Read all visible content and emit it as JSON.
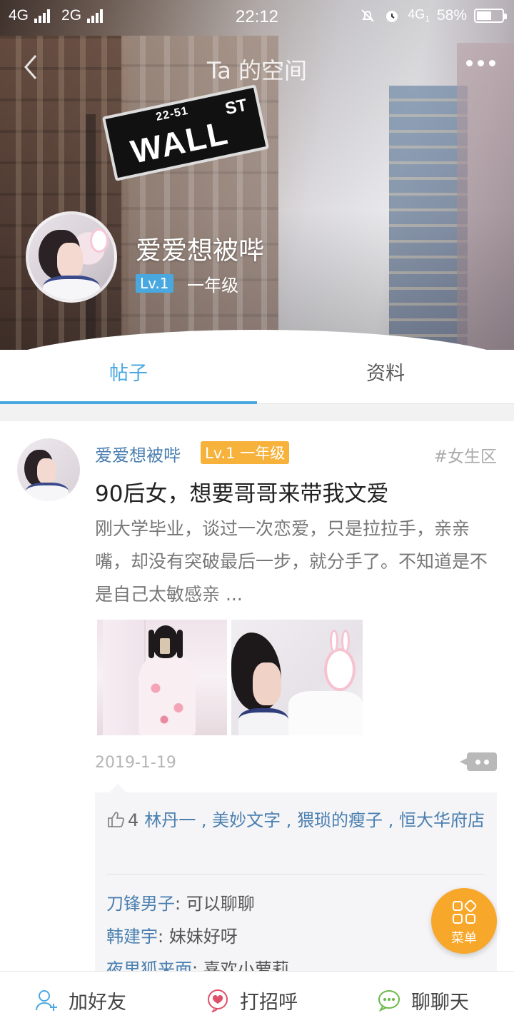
{
  "status_bar": {
    "network1": "4G",
    "network2": "2G",
    "time": "22:12",
    "network3": "4G",
    "network3_sub": "1",
    "battery": "58%",
    "battery_level": 0.58
  },
  "nav": {
    "title": "Ta 的空间"
  },
  "cover": {
    "sign_number": "22-51",
    "sign_main": "WALL",
    "sign_st": "ST"
  },
  "profile": {
    "name": "爱爱想被哔",
    "level": "Lv.1",
    "grade": "一年级"
  },
  "tabs": [
    {
      "label": "帖子",
      "active": true
    },
    {
      "label": "资料",
      "active": false
    }
  ],
  "post": {
    "author": "爱爱想被哔",
    "level_badge": "Lv.1 一年级",
    "tag": "#女生区",
    "title": "90后女，想要哥哥来带我文爱",
    "body": "刚大学毕业，谈过一次恋爱，只是拉拉手，亲亲嘴，却没有突破最后一步，就分手了。不知道是不是自己太敏感亲 ...",
    "date": "2019-1-19",
    "like_count": "4",
    "likers": [
      "林丹一",
      "美妙文字",
      "猥琐的瘦子",
      "恒大华府店"
    ],
    "comments": [
      {
        "author": "刀锋男子",
        "text": "可以聊聊"
      },
      {
        "author": "韩建宇",
        "text": "妹妹好呀"
      },
      {
        "author": "夜里狐来面",
        "text": "喜欢小萝莉"
      }
    ]
  },
  "fab": {
    "label": "菜单"
  },
  "bottom_bar": {
    "add_friend": "加好友",
    "greet": "打招呼",
    "chat": "聊聊天"
  },
  "colors": {
    "accent_blue": "#4aa8e0",
    "link_blue": "#4a7fb0",
    "level_orange": "#f6b23b",
    "fab_orange": "#f7a72a",
    "greet_red": "#e0506a",
    "chat_green": "#6ab84a"
  },
  "icons": {
    "back": "chevron-left-icon",
    "more": "more-dots-icon",
    "thumb": "thumbs-up-icon",
    "comment": "comment-bubble-icon",
    "menu": "menu-grid-icon",
    "add_friend": "add-user-icon",
    "greet": "heart-bubble-icon",
    "chat": "chat-bubble-icon"
  }
}
